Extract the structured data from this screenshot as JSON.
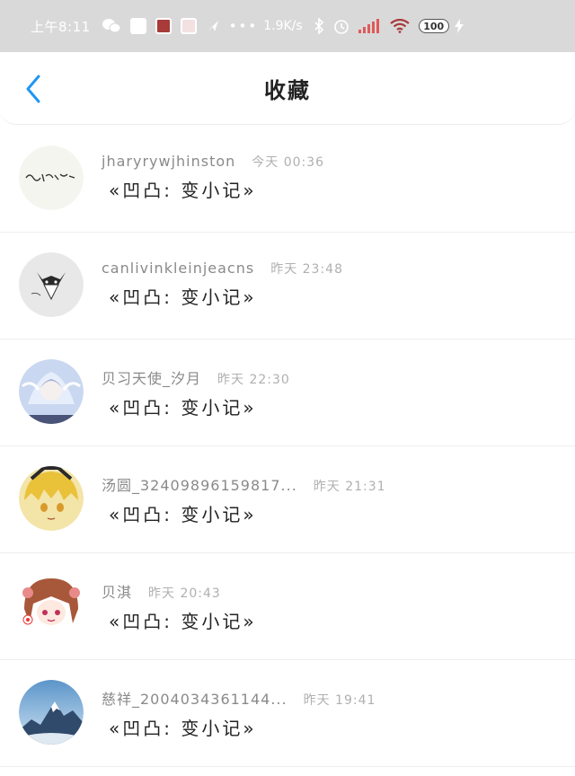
{
  "status_bar": {
    "time": "上午8:11",
    "dots": "•••",
    "network_speed": "1.9K/s",
    "battery": "100",
    "icons": [
      "wechat-icon",
      "message-icon",
      "app-icon",
      "note-icon",
      "gps-icon",
      "bluetooth-icon",
      "alarm-icon",
      "signal-icon",
      "wifi-icon",
      "battery-icon",
      "charging-icon"
    ]
  },
  "nav": {
    "title": "收藏",
    "back_icon": "chevron-left-icon",
    "accent": "#2196f3"
  },
  "items": [
    {
      "username": "jharyrywjhinston",
      "time": "今天 00:36",
      "message": "«凹凸: 变小记»",
      "avatar": "calligraphy-avatar"
    },
    {
      "username": "canlivinkleinjeacns",
      "time": "昨天 23:48",
      "message": "«凹凸: 变小记»",
      "avatar": "wolf-avatar"
    },
    {
      "username": "贝习天使_汐月",
      "time": "昨天 22:30",
      "message": "«凹凸: 变小记»",
      "avatar": "angel-avatar"
    },
    {
      "username": "汤圆_32409896159817...",
      "time": "昨天 21:31",
      "message": "«凹凸: 变小记»",
      "avatar": "yellow-hair-avatar"
    },
    {
      "username": "贝淇",
      "time": "昨天 20:43",
      "message": "«凹凸: 变小记»",
      "avatar": "brown-hair-avatar"
    },
    {
      "username": "慈祥_2004034361144...",
      "time": "昨天 19:41",
      "message": "«凹凸: 变小记»",
      "avatar": "mountain-avatar"
    }
  ]
}
